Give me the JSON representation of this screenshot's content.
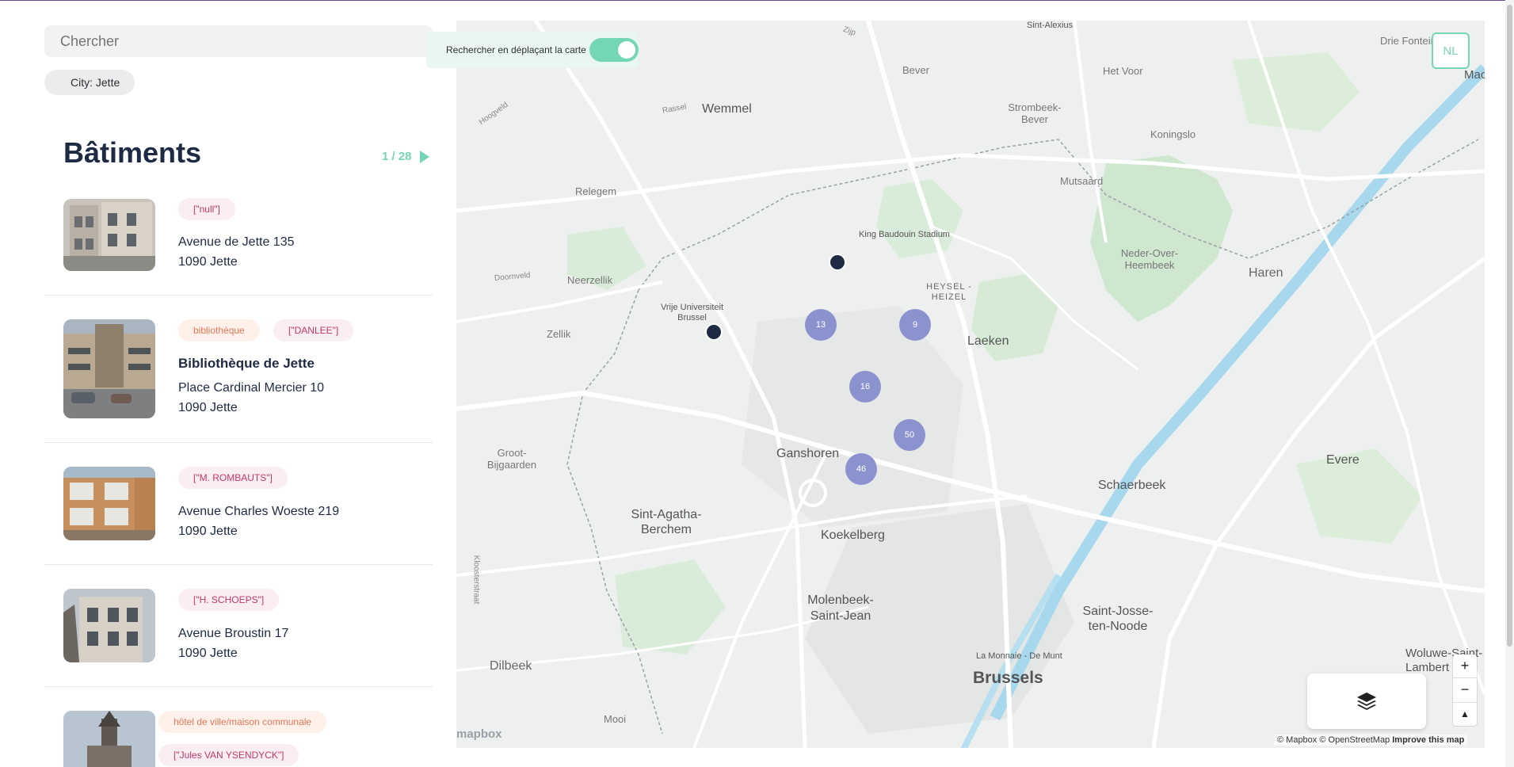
{
  "search": {
    "placeholder": "Chercher"
  },
  "filter_chip": "City: Jette",
  "list": {
    "title": "Bâtiments",
    "pager": "1 / 28",
    "items": [
      {
        "tags": [
          "[\"null\"]"
        ],
        "name": "",
        "street": "Avenue de Jette 135",
        "city": "1090 Jette"
      },
      {
        "type": "bibliothèque",
        "tags": [
          "[\"DANLEE\"]"
        ],
        "name": "Bibliothèque de Jette",
        "street": "Place Cardinal Mercier 10",
        "city": "1090 Jette"
      },
      {
        "tags": [
          "[\"M. ROMBAUTS\"]"
        ],
        "name": "",
        "street": "Avenue Charles Woeste 219",
        "city": "1090 Jette"
      },
      {
        "tags": [
          "[\"H. SCHOEPS\"]"
        ],
        "name": "",
        "street": "Avenue Broustin 17",
        "city": "1090 Jette"
      },
      {
        "type": "hôtel de ville/maison communale",
        "tags": [
          "[\"Jules VAN YSENDYCK\"]"
        ],
        "name": "",
        "street": "",
        "city": ""
      }
    ]
  },
  "map": {
    "toggle_label": "Rechercher en déplaçant la carte",
    "toggle_on": true,
    "language_button": "NL",
    "places": {
      "wemmel": "Wemmel",
      "relegem": "Relegem",
      "neerzellik": "Neerzellik",
      "zellik": "Zellik",
      "bever": "Bever",
      "strombeek": "Strombeek-Bever",
      "het_voor": "Het Voor",
      "koningslo": "Koningslo",
      "mutsaard": "Mutsaard",
      "king_baudouin": "King Baudouin Stadium",
      "heysel": "HEYSEL - HEIZEL",
      "laeken": "Laeken",
      "neder": "Neder-Over-Heembeek",
      "haren": "Haren",
      "vub": "Vrije Universiteit Brussel",
      "ganshoren": "Ganshoren",
      "groot": "Groot-Bijgaarden",
      "sint_agatha": "Sint-Agatha-Berchem",
      "koekelberg": "Koekelberg",
      "molenbeek": "Molenbeek-Saint-Jean",
      "schaerbeek": "Schaerbeek",
      "evere": "Evere",
      "saint_josse": "Saint-Josse-ten-Noode",
      "monnaie": "La Monnaie - De Munt",
      "brussels": "Brussels",
      "dilbeek": "Dilbeek",
      "mooi": "Mooi",
      "drie": "Drie Fonteinen",
      "sint_alexius": "Sint-Alexius",
      "woluwe": "Woluwe-Saint-Lambert",
      "mac": "Mac",
      "zijp": "Zijp",
      "rassel": "Rassel",
      "hoogveld": "Hoogveld",
      "doornveld": "Doornveld",
      "kloosterstraat": "Kloosterstraat"
    },
    "clusters": [
      {
        "label": "13"
      },
      {
        "label": "9"
      },
      {
        "label": "16"
      },
      {
        "label": "50"
      },
      {
        "label": "46"
      }
    ],
    "attribution": {
      "mapbox": "© Mapbox",
      "osm": "© OpenStreetMap",
      "improve": "Improve this map"
    },
    "logo": "mapbox",
    "zoom_in": "+",
    "zoom_out": "−",
    "compass": "▲"
  },
  "colors": {
    "accent": "#74d6b6",
    "cluster": "#8b93cf",
    "marker": "#1f2a44",
    "tag_text": "#c0396b",
    "type_text": "#e4795a"
  }
}
